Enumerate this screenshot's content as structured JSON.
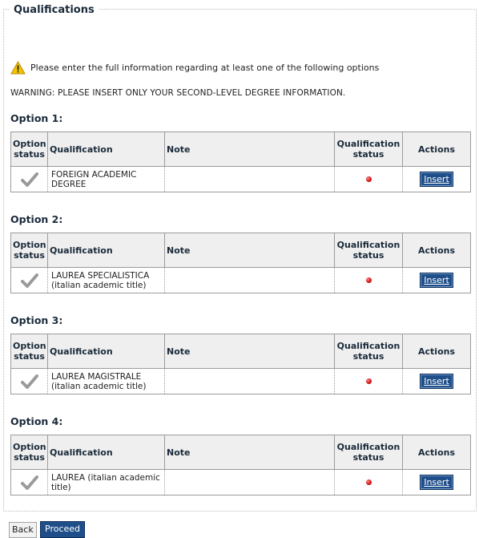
{
  "section_title": "Qualifications",
  "notice": {
    "icon": "warning-icon",
    "text": "Please enter the full information regarding at least one of the following options"
  },
  "warning": "WARNING: PLEASE INSERT ONLY YOUR SECOND-LEVEL DEGREE INFORMATION.",
  "columns": {
    "option_status": "Option status",
    "qualification": "Qualification",
    "note": "Note",
    "qualification_status": "Qualification status",
    "actions": "Actions"
  },
  "options": [
    {
      "title": "Option 1:",
      "qualification": "FOREIGN ACADEMIC DEGREE",
      "note": "",
      "status_icon": "check-icon",
      "qual_status_icon": "red-dot-icon",
      "action": "Insert"
    },
    {
      "title": "Option 2:",
      "qualification": "LAUREA SPECIALISTICA (italian academic title)",
      "note": "",
      "status_icon": "check-icon",
      "qual_status_icon": "red-dot-icon",
      "action": "Insert"
    },
    {
      "title": "Option 3:",
      "qualification": "LAUREA MAGISTRALE (italian academic title)",
      "note": "",
      "status_icon": "check-icon",
      "qual_status_icon": "red-dot-icon",
      "action": "Insert"
    },
    {
      "title": "Option 4:",
      "qualification": "LAUREA (italian academic title)",
      "note": "",
      "status_icon": "check-icon",
      "qual_status_icon": "red-dot-icon",
      "action": "Insert"
    }
  ],
  "buttons": {
    "back": "Back",
    "proceed": "Proceed"
  },
  "colors": {
    "button_blue": "#1f4f8a",
    "status_red": "#d41414",
    "header_bg": "#efefef"
  }
}
